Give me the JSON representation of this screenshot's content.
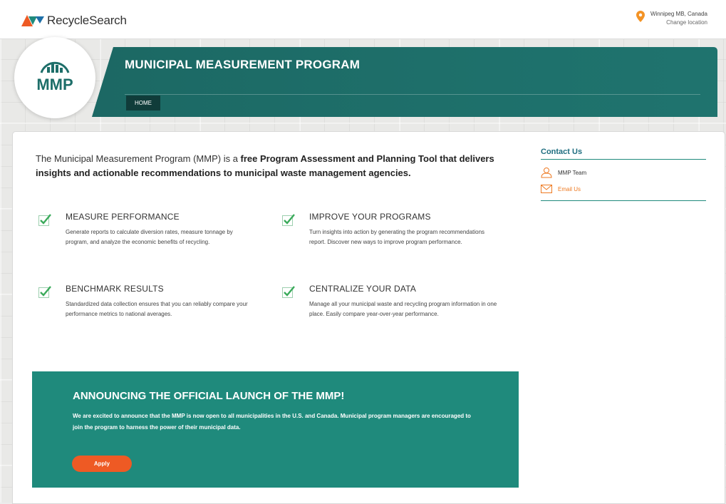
{
  "header": {
    "brand": "RecycleSearch",
    "location": "Winnipeg MB, Canada",
    "change_location": "Change location"
  },
  "logo": {
    "text": "MMP"
  },
  "banner": {
    "title": "MUNICIPAL MEASUREMENT PROGRAM",
    "home_tab": "HOME"
  },
  "intro": {
    "part1": "The Municipal Measurement Program (MMP) is a ",
    "free": "free",
    "part2": " ",
    "program_assessment": "Program Assessment and Planning Tool",
    "part3": " that delivers insights and actionable recommendations to municipal waste management agencies."
  },
  "features": [
    {
      "title": "MEASURE PERFORMANCE",
      "desc": "Generate reports to calculate diversion rates, measure tonnage by program, and analyze the economic benefits of recycling."
    },
    {
      "title": "IMPROVE YOUR PROGRAMS",
      "desc": "Turn insights into action by generating the program recommendations report. Discover new ways to improve program performance."
    },
    {
      "title": "BENCHMARK RESULTS",
      "desc": "Standardized data collection ensures that you can reliably compare your performance metrics to national averages."
    },
    {
      "title": "CENTRALIZE YOUR DATA",
      "desc": "Manage all your municipal waste and recycling program information in one place. Easily compare year-over-year performance."
    }
  ],
  "announcement": {
    "title": "ANNOUNCING THE OFFICIAL LAUNCH OF THE MMP!",
    "text": "We are excited to announce that the MMP is now open to all municipalities in the U.S. and Canada. Municipal program managers are encouraged to join the program to harness the power of their municipal data.",
    "button": "Apply"
  },
  "contact": {
    "title": "Contact Us",
    "team": "MMP Team",
    "email": "Email Us"
  },
  "colors": {
    "teal": "#1f8a7c",
    "dark_teal": "#103c3a",
    "orange": "#ee5a24",
    "check_green": "#3aaa5a"
  }
}
